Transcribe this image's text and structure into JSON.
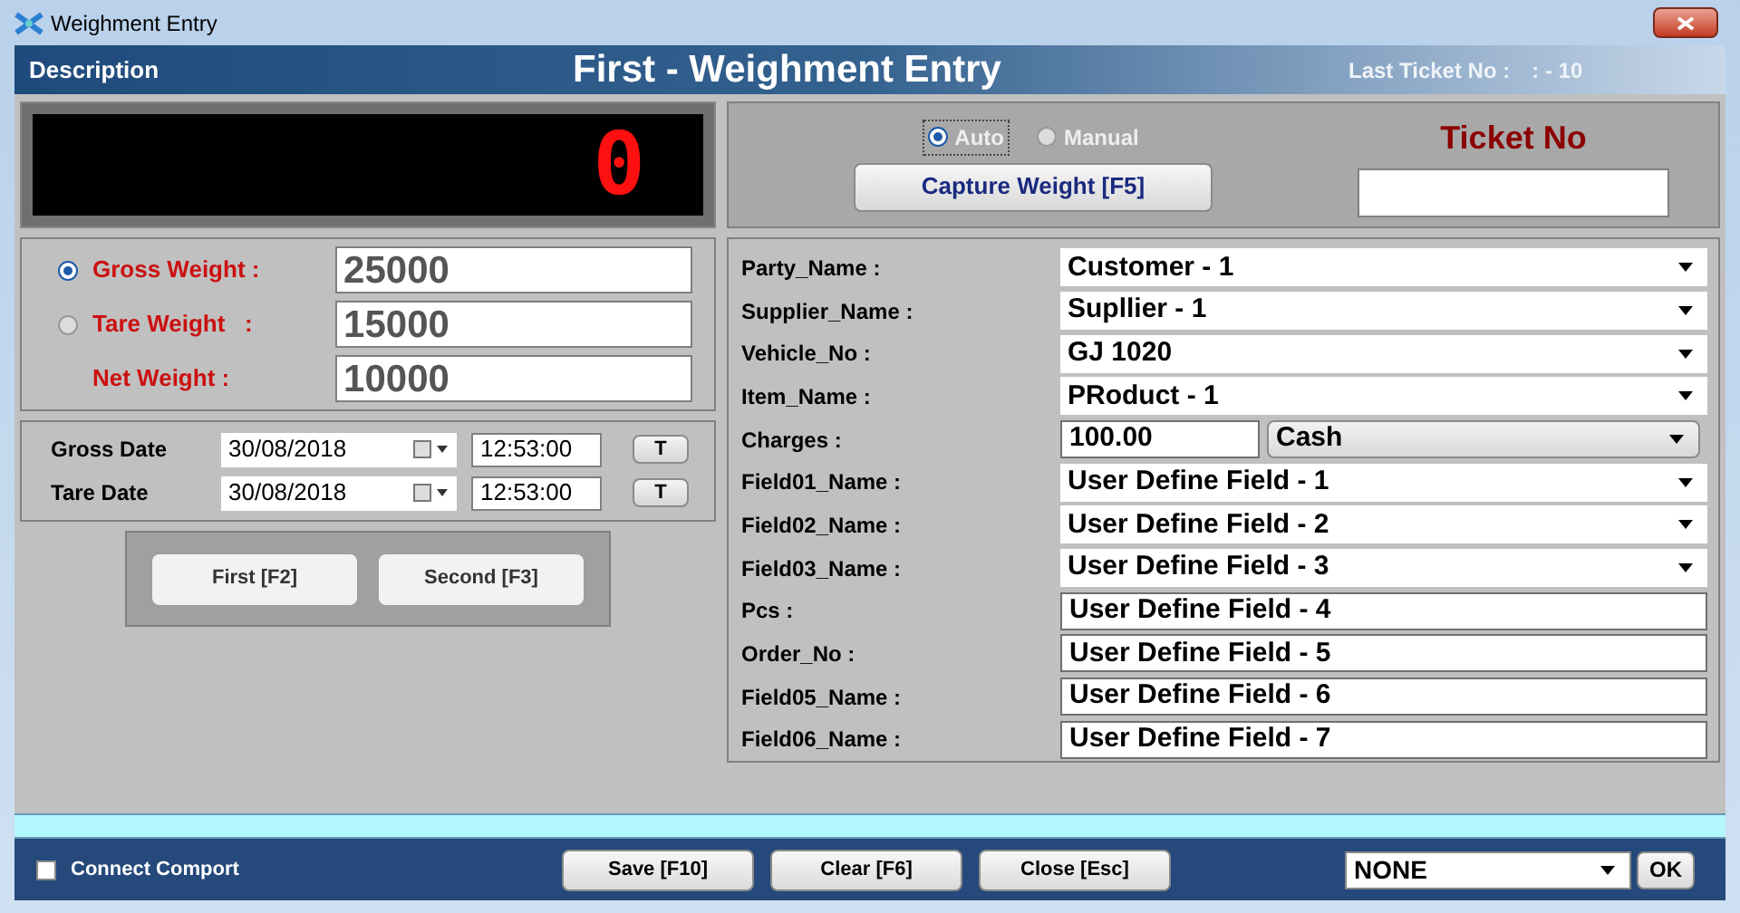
{
  "window": {
    "title": "Weighment Entry"
  },
  "header": {
    "description": "Description",
    "title": "First - Weighment Entry",
    "last_ticket_label": "Last Ticket No :",
    "last_ticket_value": ": - 10"
  },
  "display": {
    "reading": "0"
  },
  "weights": [
    {
      "kind": "radio",
      "label": "Gross Weight :",
      "value": "25000",
      "selected": true
    },
    {
      "kind": "radio",
      "label": "Tare Weight   :",
      "value": "15000",
      "selected": false
    },
    {
      "kind": "plain",
      "label": "Net Weight :",
      "value": "10000"
    }
  ],
  "dates": [
    {
      "label": "Gross Date",
      "date": "30/08/2018",
      "time": "12:53:00",
      "button": "T"
    },
    {
      "label": "Tare Date",
      "date": "30/08/2018",
      "time": "12:53:00",
      "button": "T"
    }
  ],
  "entry_buttons": [
    "First [F2]",
    "Second [F3]"
  ],
  "mode": [
    {
      "label": "Auto",
      "selected": true
    },
    {
      "label": "Manual",
      "selected": false
    }
  ],
  "capture_button": "Capture Weight [F5]",
  "ticket": {
    "label": "Ticket No"
  },
  "fields": [
    {
      "label": "Party_Name :",
      "kind": "dropdown",
      "value": "Customer - 1"
    },
    {
      "label": "Supplier_Name :",
      "kind": "dropdown",
      "value": "Supllier - 1"
    },
    {
      "label": "Vehicle_No :",
      "kind": "dropdown",
      "value": "GJ 1020"
    },
    {
      "label": "Item_Name :",
      "kind": "dropdown",
      "value": "PRoduct - 1"
    },
    {
      "label": "Charges :",
      "kind": "charges",
      "value": "100.00",
      "option": "Cash"
    },
    {
      "label": "Field01_Name :",
      "kind": "dropdown",
      "value": "User Define Field - 1"
    },
    {
      "label": "Field02_Name :",
      "kind": "dropdown",
      "value": "User Define Field - 2"
    },
    {
      "label": "Field03_Name :",
      "kind": "dropdown",
      "value": "User Define Field - 3"
    },
    {
      "label": "Pcs :",
      "kind": "text",
      "value": "User Define Field - 4"
    },
    {
      "label": "Order_No :",
      "kind": "text",
      "value": "User Define Field - 5"
    },
    {
      "label": "Field05_Name :",
      "kind": "text",
      "value": "User Define Field - 6"
    },
    {
      "label": "Field06_Name :",
      "kind": "text",
      "value": "User Define Field - 7"
    }
  ],
  "footer": {
    "comport": {
      "label": "Connect Comport",
      "checked": false
    },
    "buttons": [
      "Save [F10]",
      "Clear [F6]",
      "Close [Esc]"
    ],
    "port": "NONE",
    "ok": "OK"
  }
}
